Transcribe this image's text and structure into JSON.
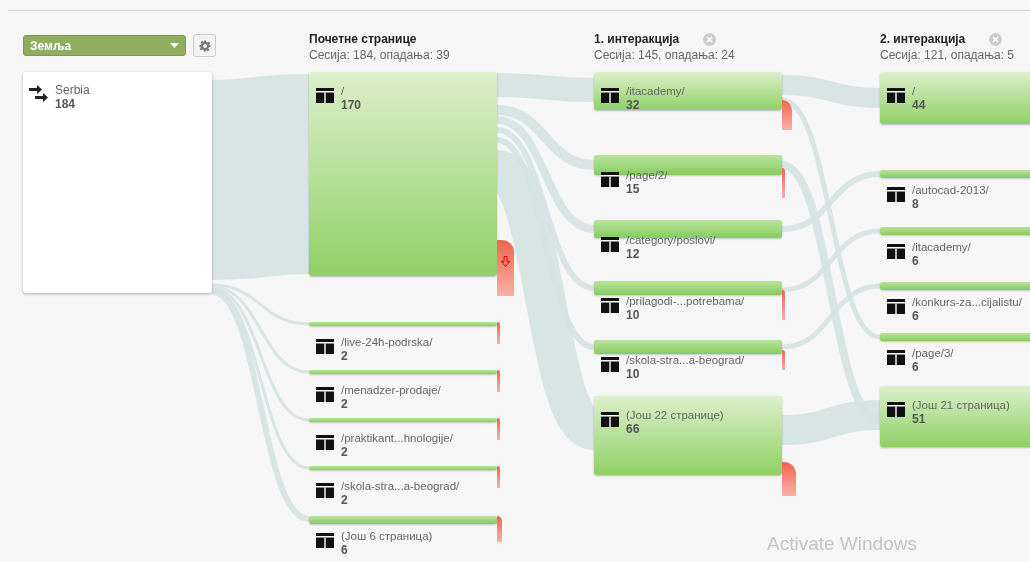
{
  "dimension_select": {
    "value": "Земља"
  },
  "source": {
    "label": "Serbia",
    "count": "184"
  },
  "columns": [
    {
      "title": "Почетне странице",
      "stats": "Сесија: 184, опадања: 39",
      "closable": false,
      "nodes": [
        {
          "label": "/",
          "count": "170",
          "dropoff": true
        },
        {
          "label": "/live-24h-podrska/",
          "count": "2",
          "dropoff": true
        },
        {
          "label": "/menadzer-prodaje/",
          "count": "2",
          "dropoff": true
        },
        {
          "label": "/praktikant...hnologije/",
          "count": "2",
          "dropoff": true
        },
        {
          "label": "/skola-stra...a-beograd/",
          "count": "2",
          "dropoff": true
        },
        {
          "label": "(Још 6 страница)",
          "count": "6",
          "dropoff": true
        }
      ]
    },
    {
      "title": "1. интеракција",
      "stats": "Сесија: 145, опадања: 24",
      "closable": true,
      "nodes": [
        {
          "label": "/itacademy/",
          "count": "32",
          "dropoff": true
        },
        {
          "label": "/page/2/",
          "count": "15",
          "dropoff": true
        },
        {
          "label": "/category/poslovi/",
          "count": "12",
          "dropoff": false
        },
        {
          "label": "/prilagodi-...potrebama/",
          "count": "10",
          "dropoff": true
        },
        {
          "label": "/skola-stra...a-beograd/",
          "count": "10",
          "dropoff": true
        },
        {
          "label": "(Још 22 странице)",
          "count": "66",
          "dropoff": true
        }
      ]
    },
    {
      "title": "2. интеракција",
      "stats": "Сесија: 121, опадања: 5",
      "closable": true,
      "nodes": [
        {
          "label": "/",
          "count": "44"
        },
        {
          "label": "/autocad-2013/",
          "count": "8"
        },
        {
          "label": "/itacademy/",
          "count": "6"
        },
        {
          "label": "/konkurs-za...cijalistu/",
          "count": "6"
        },
        {
          "label": "/page/3/",
          "count": "6"
        },
        {
          "label": "(Још 21 страница)",
          "count": "51"
        }
      ]
    }
  ],
  "overlay_notice": "Activate Windows"
}
